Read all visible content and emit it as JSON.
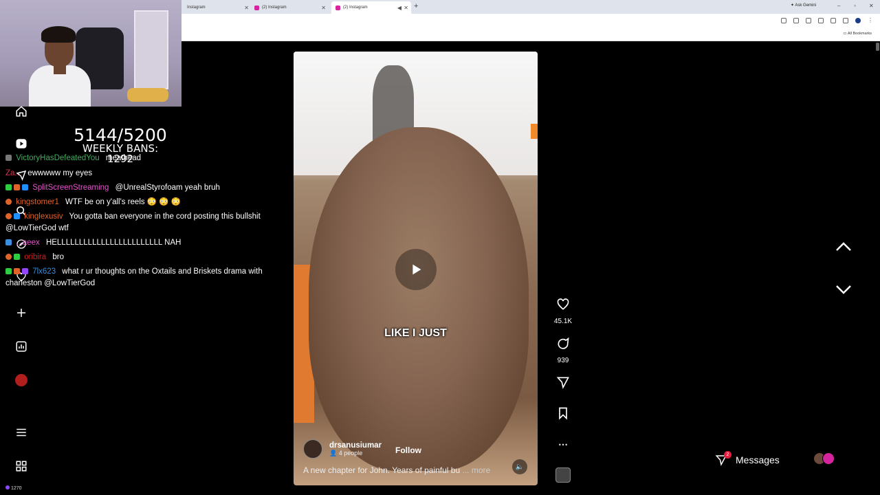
{
  "browser": {
    "tabs": [
      {
        "title": "Instagram",
        "active": false
      },
      {
        "title": "(2) Instagram",
        "active": false
      },
      {
        "title": "(2) Instagram",
        "active": true
      }
    ],
    "gemini_label": "Ask Gemini",
    "all_bookmarks": "All Bookmarks"
  },
  "stream": {
    "ban_count": "5144/5200",
    "weekly_bans": "WEEKLY BANS: 1292",
    "chat": [
      {
        "user": "VictoryHasDefeatedYou",
        "user_color": "#3fae60",
        "msg": "meathead"
      },
      {
        "user": "Za...",
        "user_color": "#e0304a",
        "msg": "ewwwww my eyes"
      },
      {
        "user": "SplitScreenStreaming",
        "user_color": "#e255c8",
        "msg": "@UnrealStyrofoam yeah bruh"
      },
      {
        "user": "kingstomer1",
        "user_color": "#e0642a",
        "msg": "WTF be on y'all's reels 😳 😳 😳"
      },
      {
        "user": "kinglexusiv",
        "user_color": "#e0642a",
        "msg": "You gotta ban everyone in the cord posting this bullshit @LowTierGod wtf"
      },
      {
        "user": "...aeex",
        "user_color": "#e255c8",
        "msg": "HELLLLLLLLLLLLLLLLLLLLLLLL NAH"
      },
      {
        "user": "oribira",
        "user_color": "#d02020",
        "msg": "bro"
      },
      {
        "user": "7lx623",
        "user_color": "#3a8fe0",
        "msg": "what r ur thoughts on the Oxtails and Briskets drama with charleston @LowTierGod"
      }
    ],
    "viewer_count": "1270"
  },
  "reel": {
    "subtitle": "LIKE I JUST",
    "author": "drsanusiumar",
    "author_sub": "4 people",
    "follow_label": "Follow",
    "description": "A new chapter for John. Years of painful bu",
    "more_label": "... more",
    "likes": "45.1K",
    "comments": "939"
  },
  "messages": {
    "label": "Messages",
    "badge": "2"
  },
  "colors": {
    "chat_green_badge": "#2ecc40",
    "badge_red": "#e41e3f"
  }
}
